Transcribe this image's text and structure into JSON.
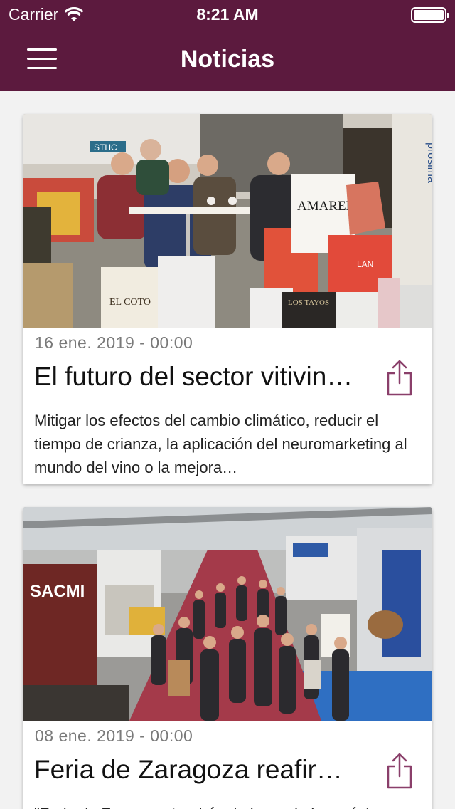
{
  "status_bar": {
    "carrier": "Carrier",
    "time": "8:21 AM",
    "wifi_icon": "wifi-icon",
    "battery_icon": "battery-icon"
  },
  "nav": {
    "title": "Noticias",
    "menu_icon": "hamburger-menu-icon"
  },
  "colors": {
    "header_bg": "#5c1a3e",
    "accent": "#8a3f6a",
    "background": "#f2f2f2"
  },
  "articles": [
    {
      "date": "16 ene. 2019 - 00:00",
      "title": "El futuro del sector vitivin…",
      "summary": "Mitigar los efectos del cambio climático, reducir el tiempo de crianza, la aplicación del neuromarketing al mundo del vino o la mejora…",
      "image_desc_icon": "photo-wine-fair-meeting",
      "share_icon": "share-icon",
      "photo_texts": {
        "brand": "AMAREN",
        "box": "EL COTO",
        "box2": "LOS TAYOS",
        "box3": "LAN",
        "booth": "STHC",
        "side": "prosima"
      }
    },
    {
      "date": "08 ene. 2019 - 00:00",
      "title": "Feria de Zaragoza reafir…",
      "summary": "\"Feria de Zaragoza tendrá a lo largo de los próximos…",
      "image_desc_icon": "photo-trade-fair-crowd",
      "share_icon": "share-icon",
      "photo_texts": {
        "brand": "SACMI"
      }
    }
  ]
}
